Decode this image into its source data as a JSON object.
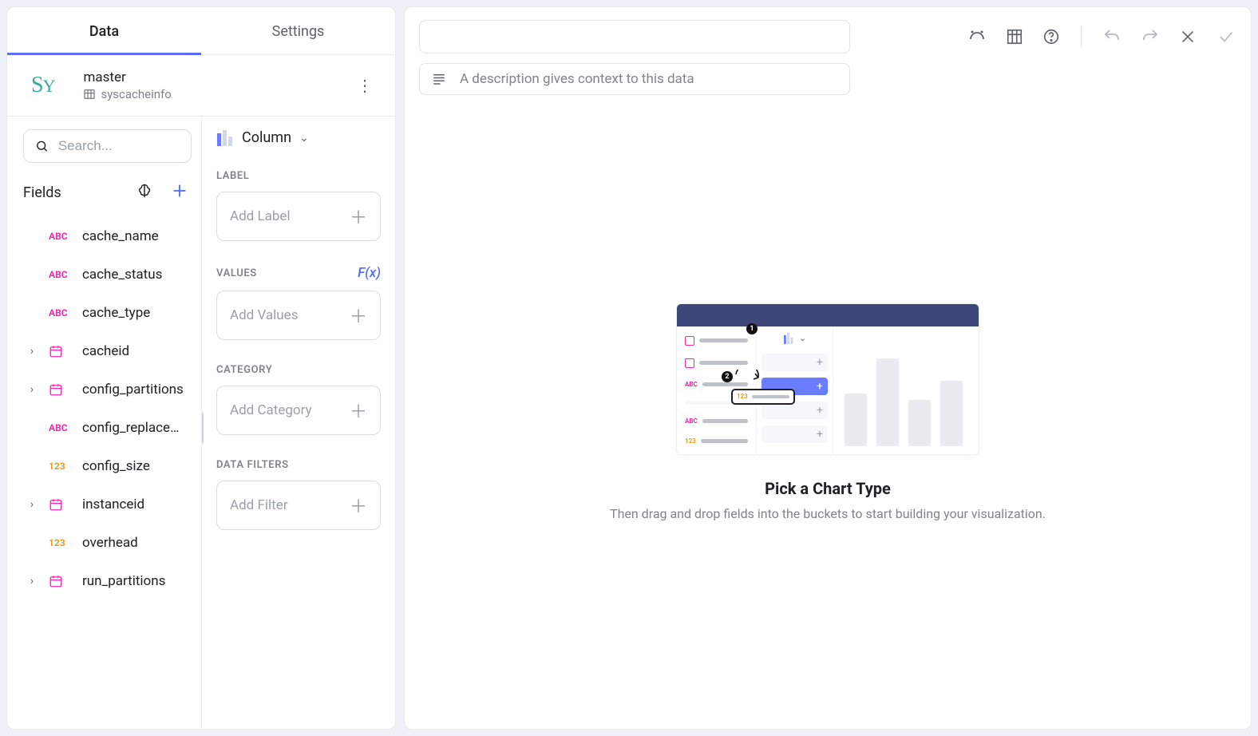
{
  "tabs": {
    "data": "Data",
    "settings": "Settings"
  },
  "source": {
    "logo": "Sy",
    "title": "master",
    "subtitle": "syscacheinfo"
  },
  "search": {
    "placeholder": "Search..."
  },
  "fieldsHeader": "Fields",
  "fields": [
    {
      "type": "abc",
      "name": "cache_name",
      "expandable": false
    },
    {
      "type": "abc",
      "name": "cache_status",
      "expandable": false
    },
    {
      "type": "abc",
      "name": "cache_type",
      "expandable": false
    },
    {
      "type": "cal",
      "name": "cacheid",
      "expandable": true
    },
    {
      "type": "cal",
      "name": "config_partitions",
      "expandable": true
    },
    {
      "type": "abc",
      "name": "config_replace…",
      "expandable": false
    },
    {
      "type": "123",
      "name": "config_size",
      "expandable": false
    },
    {
      "type": "cal",
      "name": "instanceid",
      "expandable": true
    },
    {
      "type": "123",
      "name": "overhead",
      "expandable": false
    },
    {
      "type": "cal",
      "name": "run_partitions",
      "expandable": true
    }
  ],
  "chartType": "Column",
  "buckets": {
    "label": {
      "title": "LABEL",
      "placeholder": "Add Label"
    },
    "values": {
      "title": "VALUES",
      "placeholder": "Add Values",
      "fx": "F(x)"
    },
    "category": {
      "title": "CATEGORY",
      "placeholder": "Add Category"
    },
    "filters": {
      "title": "DATA FILTERS",
      "placeholder": "Add Filter"
    }
  },
  "description": {
    "placeholder": "A description gives context to this data"
  },
  "emptyState": {
    "title": "Pick a Chart Type",
    "subtitle": "Then drag and drop fields into the buckets to start building your visualization."
  }
}
